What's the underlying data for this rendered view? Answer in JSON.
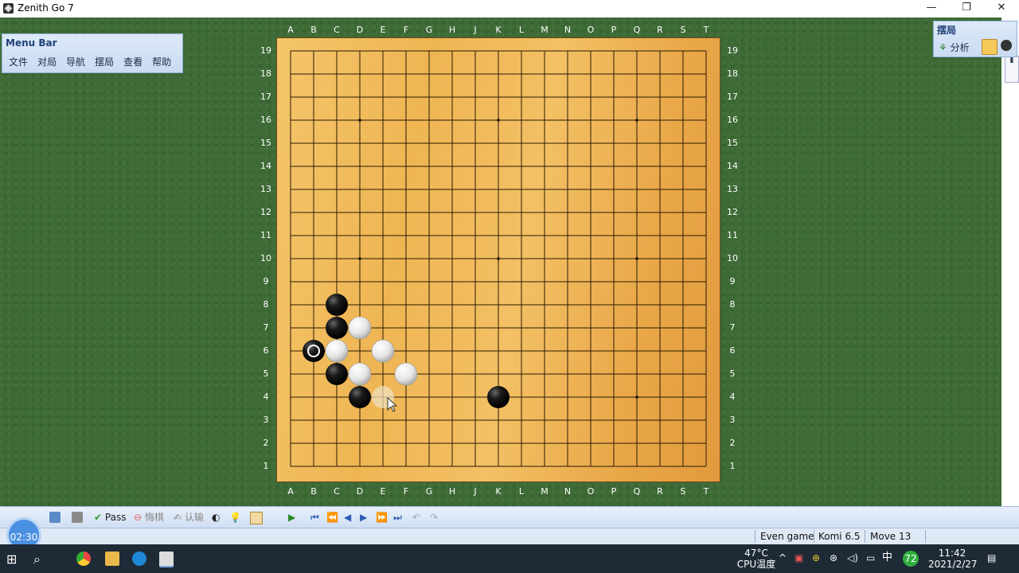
{
  "window": {
    "title": "Zenith Go 7",
    "minimize": "—",
    "restore": "❐",
    "close": "✕"
  },
  "menu_panel": {
    "title": "Menu Bar",
    "items": [
      "文件",
      "对局",
      "导航",
      "摆局",
      "查看",
      "帮助"
    ]
  },
  "right_panel": {
    "title": "摆局",
    "analyze_label": "分析"
  },
  "board": {
    "columns": [
      "A",
      "B",
      "C",
      "D",
      "E",
      "F",
      "G",
      "H",
      "J",
      "K",
      "L",
      "M",
      "N",
      "O",
      "P",
      "Q",
      "R",
      "S",
      "T"
    ],
    "rows": [
      "19",
      "18",
      "17",
      "16",
      "15",
      "14",
      "13",
      "12",
      "11",
      "10",
      "9",
      "8",
      "7",
      "6",
      "5",
      "4",
      "3",
      "2",
      "1"
    ],
    "star_points": [
      "D16",
      "K16",
      "Q16",
      "D10",
      "K10",
      "Q10",
      "D4",
      "K4",
      "Q4"
    ],
    "black_stones": [
      "C8",
      "C7",
      "B6",
      "C5",
      "D4",
      "K4"
    ],
    "white_stones": [
      "D7",
      "C6",
      "E6",
      "D5",
      "F5"
    ],
    "last_move": "B6",
    "ghost_stone": "E4"
  },
  "toolbar": {
    "pass_label": "Pass",
    "undo_label": "悔棋",
    "resign_label": "认输"
  },
  "status": {
    "game_type": "Even game",
    "komi": "Komi 6.5",
    "move": "Move 13"
  },
  "timer": "02:30",
  "taskbar": {
    "temperature": "47°C",
    "cpu_label": "CPU温度",
    "ime": "中",
    "badge": "72",
    "time": "11:42",
    "date": "2021/2/27"
  },
  "colors": {
    "felt": "#3d6a35",
    "board": "#efb553",
    "accent": "#1f3f79"
  }
}
